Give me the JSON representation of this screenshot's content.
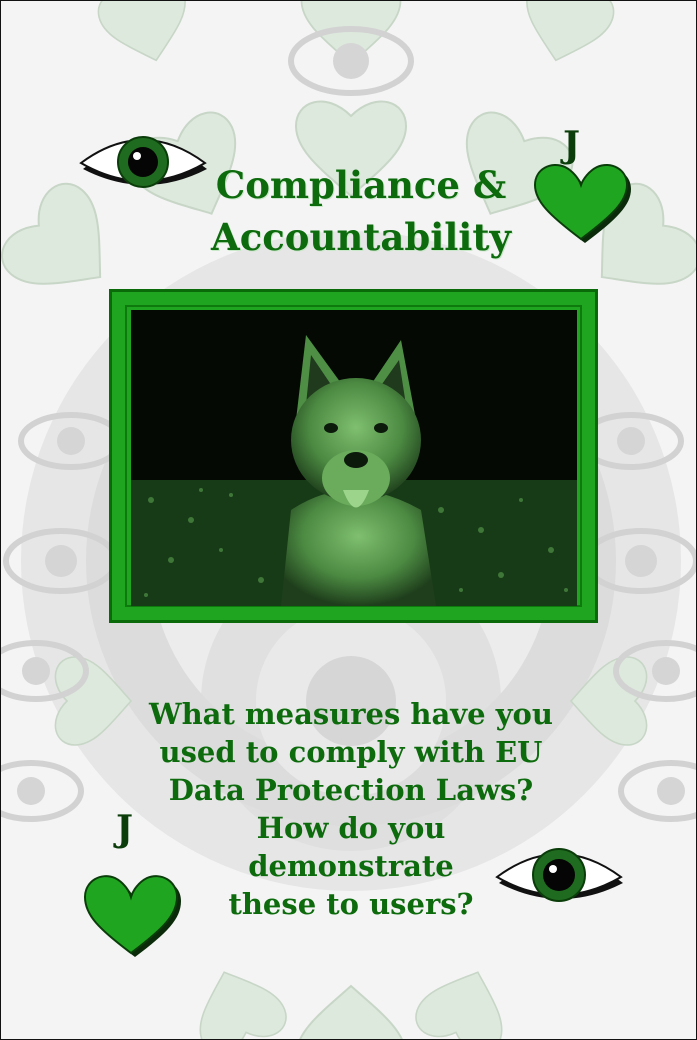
{
  "card": {
    "title_lines": [
      "Compliance &",
      "Accountability"
    ],
    "rank": "J",
    "suit_icon": "heart-icon",
    "category_icon": "eye-icon",
    "question_lines": [
      "What measures have you",
      "used to comply with EU",
      "Data Protection Laws?",
      "How do you",
      "demonstrate",
      "these to users?"
    ],
    "photo_subject": "german-shepherd-dog"
  },
  "colors": {
    "accent_green": "#1fa51f",
    "text_green": "#0d6b0d",
    "dark_green": "#0a3d0a",
    "background": "#f4f4f4"
  }
}
